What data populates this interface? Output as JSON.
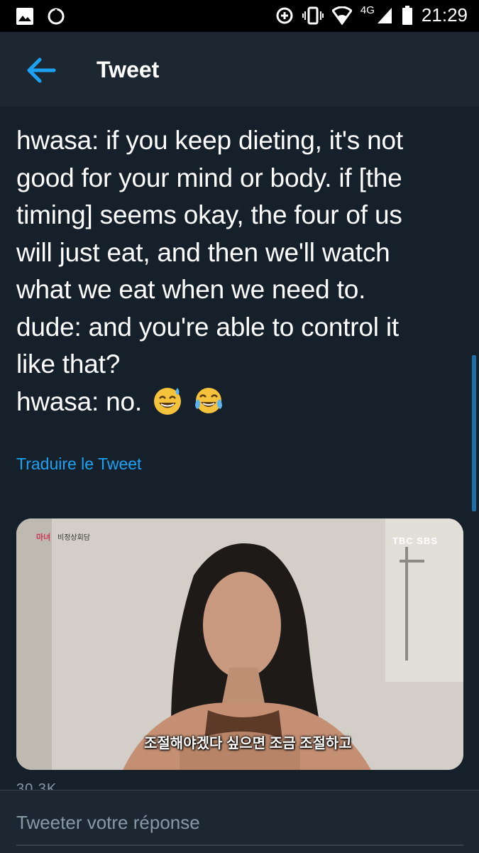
{
  "status_bar": {
    "time": "21:29",
    "network": "4G",
    "icons": [
      "image-icon",
      "circle-notification-icon",
      "data-saver-icon",
      "vibrate-icon",
      "wifi-icon",
      "signal-icon",
      "battery-icon"
    ]
  },
  "app_bar": {
    "title": "Tweet",
    "back_icon": "arrow-left-icon",
    "accent": "#1da1f2"
  },
  "tweet": {
    "lines": [
      "hwasa: if you keep dieting, it's not",
      "good for your mind or body. if [the",
      "timing] seems okay, the four of us",
      "will just eat, and then we'll watch",
      "what we eat when we need to.",
      "dude: and you're able to control it",
      "like that?",
      "hwasa: no."
    ],
    "emojis": [
      "grinning-sweat-emoji",
      "tears-of-joy-emoji"
    ],
    "translate_label": "Traduire le Tweet"
  },
  "media": {
    "subtitle": "조절해야겠다 싶으면 조금 조절하고",
    "logo_left": "마녀",
    "logo_left_sub": "비정상회담",
    "logo_right": "TBC SBS"
  },
  "counts": {
    "partial": "30.3K"
  },
  "reply": {
    "placeholder": "Tweeter votre réponse"
  }
}
